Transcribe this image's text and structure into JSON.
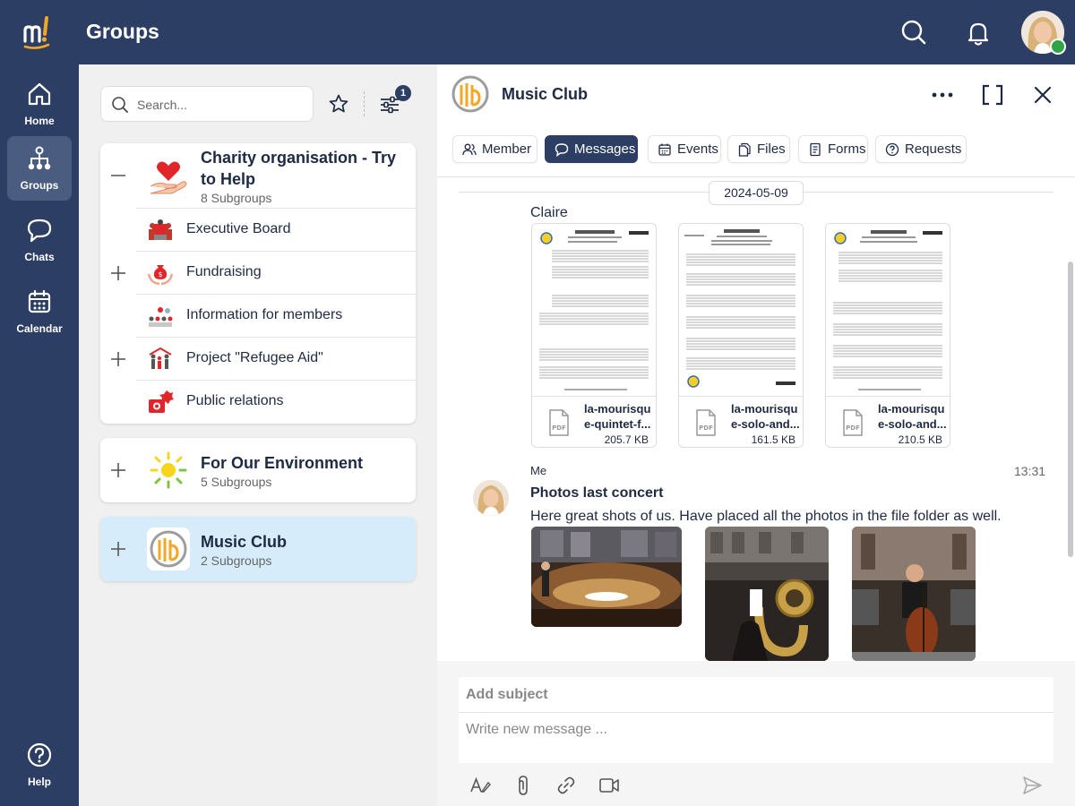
{
  "app": {
    "title": "Groups",
    "user_avatar": "user-avatar"
  },
  "colors": {
    "navy": "#2c3e63",
    "nav_active": "#4a5c80",
    "selected_group": "#d7ecfa",
    "online_badge": "#2fa548"
  },
  "nav": {
    "home": "Home",
    "groups": "Groups",
    "chats": "Chats",
    "calendar": "Calendar",
    "help": "Help"
  },
  "groups_panel": {
    "search_placeholder": "Search...",
    "filter_count": "1",
    "groups": [
      {
        "title": "Charity organisation - Try to Help",
        "subtitle": "8 Subgroups",
        "expanded": true,
        "subgroups": [
          {
            "label": "Executive Board",
            "has_children": false
          },
          {
            "label": "Fundraising",
            "has_children": true
          },
          {
            "label": "Information for members",
            "has_children": false
          },
          {
            "label": "Project \"Refugee Aid\"",
            "has_children": true
          },
          {
            "label": "Public relations",
            "has_children": false
          }
        ]
      },
      {
        "title": "For Our Environment",
        "subtitle": "5 Subgroups"
      },
      {
        "title": "Music Club",
        "subtitle": "2 Subgroups",
        "selected": true
      }
    ]
  },
  "chat": {
    "title": "Music Club",
    "tabs": [
      "Member",
      "Messages",
      "Events",
      "Files",
      "Forms",
      "Requests"
    ],
    "active_tab": "Messages",
    "date": "2024-05-09",
    "first_sender": "Claire",
    "files": [
      {
        "name_line1": "la-mourisqu",
        "name_line2": "e-quintet-f...",
        "size": "205.7 KB"
      },
      {
        "name_line1": "la-mourisqu",
        "name_line2": "e-solo-and...",
        "size": "161.5 KB"
      },
      {
        "name_line1": "la-mourisqu",
        "name_line2": "e-solo-and...",
        "size": "210.5 KB"
      }
    ],
    "message": {
      "sender": "Me",
      "time": "13:31",
      "subject": "Photos last concert",
      "text": "Here great shots of us. Have placed all the photos in the file folder as well."
    },
    "compose": {
      "subject_placeholder": "Add subject",
      "message_placeholder": "Write new message ..."
    }
  }
}
